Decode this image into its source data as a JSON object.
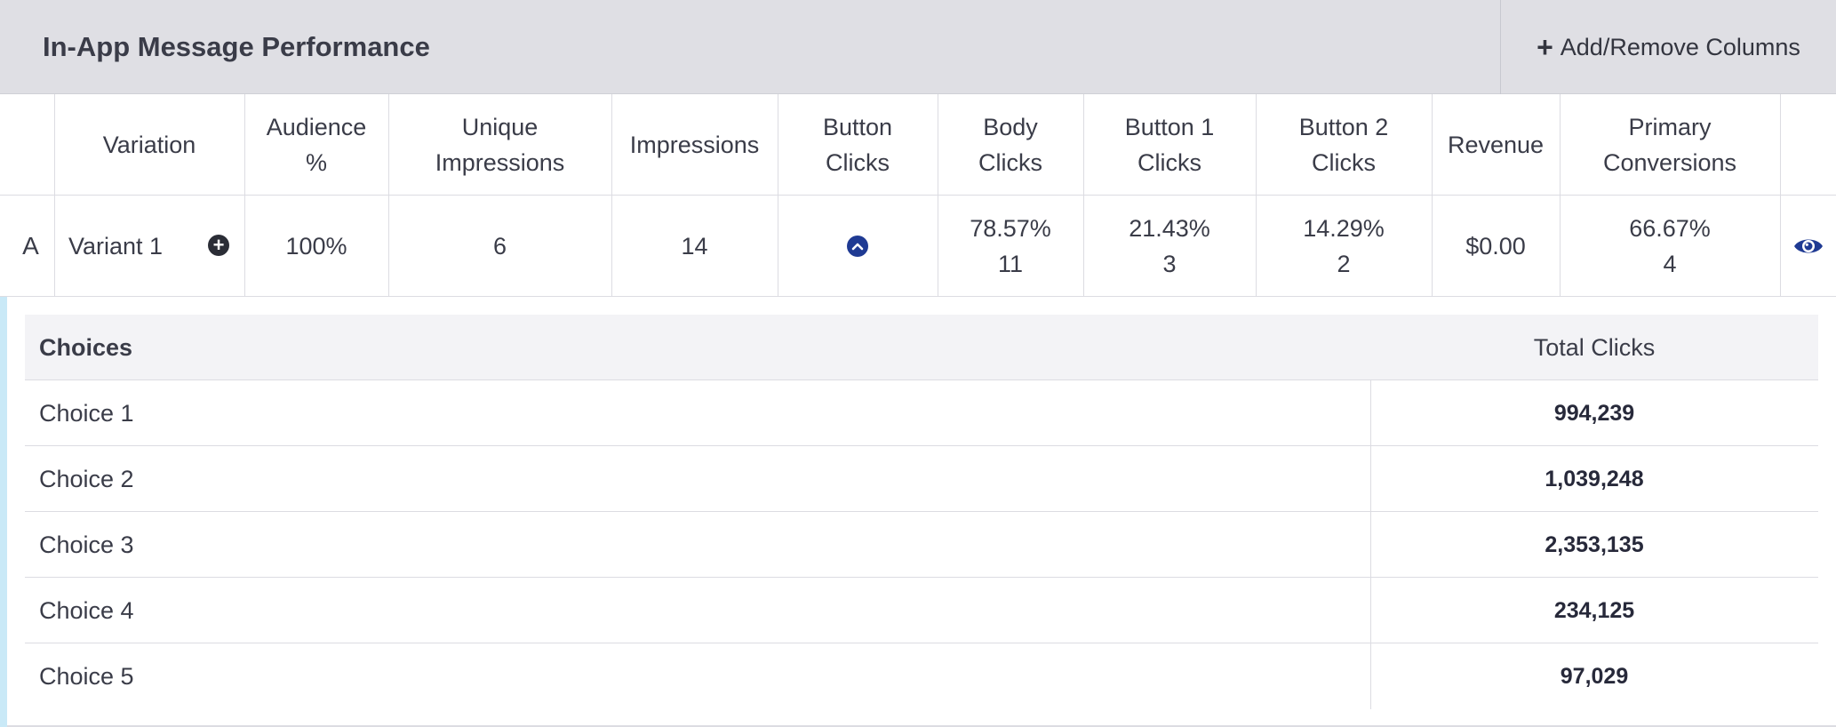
{
  "header": {
    "title": "In-App Message Performance",
    "add_remove_label": "Add/Remove Columns",
    "plus_icon": "+"
  },
  "columns": [
    {
      "key": "variation",
      "label": "Variation"
    },
    {
      "key": "audience",
      "label": "Audience %"
    },
    {
      "key": "unique_impressions",
      "label": "Unique Impressions"
    },
    {
      "key": "impressions",
      "label": "Impressions"
    },
    {
      "key": "button_clicks",
      "label": "Button Clicks"
    },
    {
      "key": "body_clicks",
      "label": "Body Clicks"
    },
    {
      "key": "button1_clicks",
      "label": "Button 1 Clicks"
    },
    {
      "key": "button2_clicks",
      "label": "Button 2 Clicks"
    },
    {
      "key": "revenue",
      "label": "Revenue"
    },
    {
      "key": "primary_conversions",
      "label": "Primary Conversions"
    }
  ],
  "variant": {
    "letter": "A",
    "name": "Variant 1",
    "audience": "100%",
    "unique_impressions": "6",
    "impressions": "14",
    "body_clicks_pct": "78.57%",
    "body_clicks_count": "11",
    "button1_pct": "21.43%",
    "button1_count": "3",
    "button2_pct": "14.29%",
    "button2_count": "2",
    "revenue": "$0.00",
    "primary_conv_pct": "66.67%",
    "primary_conv_count": "4"
  },
  "choices_panel": {
    "header_label": "Choices",
    "header_total": "Total Clicks",
    "rows": [
      {
        "name": "Choice 1",
        "total": "994,239"
      },
      {
        "name": "Choice 2",
        "total": "1,039,248"
      },
      {
        "name": "Choice 3",
        "total": "2,353,135"
      },
      {
        "name": "Choice 4",
        "total": "234,125"
      },
      {
        "name": "Choice 5",
        "total": "97,029"
      }
    ]
  },
  "colors": {
    "header_bg": "#dfdfe4",
    "accent_bar": "#c9e9f7",
    "icon_blue": "#1f3a93"
  }
}
